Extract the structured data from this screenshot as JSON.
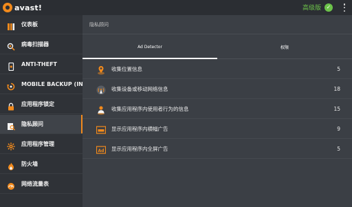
{
  "header": {
    "logo_text": "avast!",
    "premium_label": "高级版",
    "premium_check": "✓"
  },
  "sidebar": {
    "items": [
      {
        "label": "仪表板",
        "icon": "dashboard-icon",
        "active": false
      },
      {
        "label": "病毒扫描器",
        "icon": "virus-scan-icon",
        "active": false
      },
      {
        "label": "ANTI-THEFT",
        "icon": "phone-icon",
        "active": false
      },
      {
        "label": "MOBILE BACKUP (INSTALL)",
        "icon": "backup-icon",
        "active": false
      },
      {
        "label": "应用程序锁定",
        "icon": "lock-icon",
        "active": false
      },
      {
        "label": "隐私顾问",
        "icon": "privacy-icon",
        "active": true
      },
      {
        "label": "应用程序管理",
        "icon": "app-manager-icon",
        "active": false
      },
      {
        "label": "防火墙",
        "icon": "firewall-icon",
        "active": false
      },
      {
        "label": "网络流量表",
        "icon": "traffic-icon",
        "active": false
      }
    ]
  },
  "main": {
    "title": "隐私顾问",
    "tabs": [
      {
        "label": "Ad Detector",
        "active": true
      },
      {
        "label": "权限",
        "active": false
      }
    ],
    "rows": [
      {
        "label": "收集位置信息",
        "count": "5",
        "icon": "location-pin-icon"
      },
      {
        "label": "收集设备或移动网络信息",
        "count": "18",
        "icon": "signal-tower-icon"
      },
      {
        "label": "收集应用程序内使用者行为的信息",
        "count": "15",
        "icon": "user-behavior-icon"
      },
      {
        "label": "显示应用程序内横幅广告",
        "count": "9",
        "icon": "banner-ad-icon"
      },
      {
        "label": "显示应用程序内全屏广告",
        "count": "5",
        "icon": "fullscreen-ad-icon"
      }
    ]
  },
  "colors": {
    "accent": "#f28a1c",
    "premium_green": "#6cc24a",
    "sidebar_bg": "#2f3237",
    "main_bg": "#3b3f45"
  }
}
